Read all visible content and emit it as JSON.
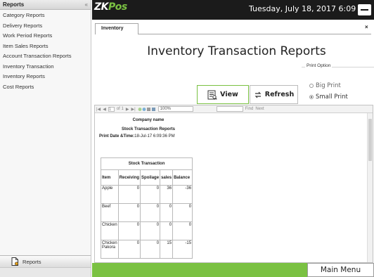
{
  "sidebar": {
    "header": "Reports",
    "collapse_glyph": "«",
    "items": [
      {
        "label": "Category Reports"
      },
      {
        "label": "Delivery Reports"
      },
      {
        "label": "Work Period Reports"
      },
      {
        "label": "Item Sales Reports"
      },
      {
        "label": "Account Transaction Reports"
      },
      {
        "label": "Inventory Transaction"
      },
      {
        "label": "Inventory Reports"
      },
      {
        "label": "Cost Reports"
      }
    ],
    "bottom_label": "Reports",
    "bottom_icon": "report-document-icon"
  },
  "topbar": {
    "brand_zk": "ZK",
    "brand_pos": "Pos",
    "datetime": "Tuesday, July 18, 2017 6:09",
    "colors": {
      "bar": "#1b1b1b",
      "brand_accent": "#7ac142"
    }
  },
  "content": {
    "tab_label": "Inventory",
    "close_glyph": "×",
    "title": "Inventory Transaction Reports",
    "view_label": "View",
    "refresh_label": "Refresh",
    "print_option": {
      "legend": "Print Option",
      "options": [
        "Big Print",
        "Small Print"
      ],
      "selected": "Small Print"
    }
  },
  "viewer": {
    "toolbar": {
      "first": "|◀",
      "prev": "◀",
      "page_current": "1",
      "page_of": "of 1",
      "next": "▶",
      "last": "▶|",
      "zoom": "100%",
      "find": "Find",
      "next_find": "Next"
    },
    "report": {
      "company": "Company name",
      "title": "Stock Transaction Reports",
      "print_date_label": "Print Date &Time:",
      "print_date_value": "18-Jul-17 6:09:36 PM",
      "table_caption": "Stock Transaction",
      "columns": [
        "Item",
        "Receiving",
        "Spoilage",
        "sales",
        "Balance"
      ],
      "rows": [
        {
          "item": "Apple",
          "receiving": "0",
          "spoilage": "0",
          "sales": "36",
          "balance": "-36"
        },
        {
          "item": "Beef",
          "receiving": "0",
          "spoilage": "0",
          "sales": "0",
          "balance": "0"
        },
        {
          "item": "Chicken",
          "receiving": "0",
          "spoilage": "0",
          "sales": "0",
          "balance": "0"
        },
        {
          "item": "Chicken Pakora",
          "receiving": "0",
          "spoilage": "0",
          "sales": "15",
          "balance": "-15"
        }
      ]
    }
  },
  "bottombar": {
    "main_menu_label": "Main Menu",
    "color": "#7ac142"
  }
}
